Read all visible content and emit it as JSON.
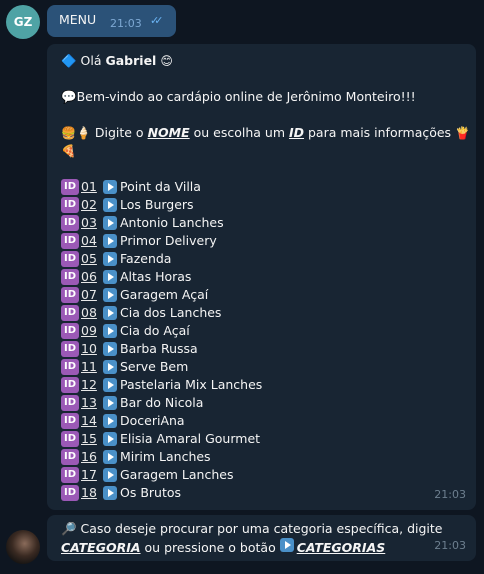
{
  "outgoing": {
    "avatar_initials": "GZ",
    "text": "MENU",
    "time": "21:03",
    "ticks": "✓✓"
  },
  "message_main": {
    "greeting_prefix": "🔷 Olá ",
    "greeting_name": "Gabriel",
    "greeting_emoji": "😊",
    "welcome": "💬Bem-vindo ao cardápio online de Jerônimo Monteiro!!!",
    "instruction": {
      "prefix_emojis": "🍔🍦",
      "text1": " Digite o ",
      "nome": "NOME",
      "text2": " ou escolha um ",
      "id": "ID",
      "text3": " para mais informações ",
      "suffix_emoji": "🍟",
      "line2_emoji": "🍕"
    },
    "badge_label": "ID",
    "items": [
      {
        "id": "01",
        "name": "Point da Villa"
      },
      {
        "id": "02",
        "name": "Los Burgers"
      },
      {
        "id": "03",
        "name": "Antonio Lanches"
      },
      {
        "id": "04",
        "name": "Primor Delivery"
      },
      {
        "id": "05",
        "name": "Fazenda"
      },
      {
        "id": "06",
        "name": "Altas Horas"
      },
      {
        "id": "07",
        "name": "Garagem Açaí"
      },
      {
        "id": "08",
        "name": "Cia dos Lanches"
      },
      {
        "id": "09",
        "name": "Cia do Açaí"
      },
      {
        "id": "10",
        "name": "Barba Russa"
      },
      {
        "id": "11",
        "name": "Serve Bem"
      },
      {
        "id": "12",
        "name": "Pastelaria Mix Lanches"
      },
      {
        "id": "13",
        "name": "Bar do Nicola"
      },
      {
        "id": "14",
        "name": "DoceriAna"
      },
      {
        "id": "15",
        "name": "Elisia Amaral Gourmet"
      },
      {
        "id": "16",
        "name": "Mirim Lanches"
      },
      {
        "id": "17",
        "name": "Garagem Lanches"
      },
      {
        "id": "18",
        "name": "Os Brutos"
      }
    ],
    "time": "21:03"
  },
  "message_second": {
    "line1": "🔎 Caso deseje procurar por uma categoria específica, digite",
    "categoria": "CATEGORIA",
    "middle": " ou pressione o botão ",
    "categorias": "CATEGORIAS",
    "time": "21:03"
  }
}
